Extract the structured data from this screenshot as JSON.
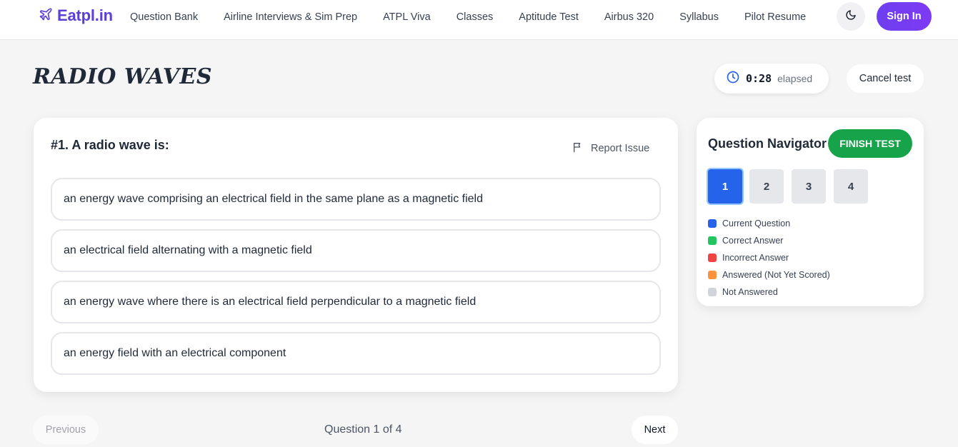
{
  "header": {
    "brand": "Eatpl.in",
    "nav_items": [
      "Question Bank",
      "Airline Interviews & Sim Prep",
      "ATPL Viva",
      "Classes",
      "Aptitude Test",
      "Airbus 320",
      "Syllabus",
      "Pilot Resume"
    ],
    "theme_icon": "moon-icon",
    "sign_in_label": "Sign In"
  },
  "page": {
    "title": "RADIO WAVES",
    "timer_value": "0:28",
    "timer_label": "elapsed",
    "cancel_label": "Cancel test"
  },
  "question": {
    "text": "#1. A radio wave is:",
    "report_label": "Report Issue",
    "options": [
      "an energy wave comprising an electrical field in the same plane as a magnetic field",
      "an electrical field alternating with a magnetic field",
      "an energy wave where there is an electrical field perpendicular to a magnetic field",
      "an energy field with an electrical component"
    ]
  },
  "navigator": {
    "title": "Question Navigator",
    "finish_label": "FINISH TEST",
    "questions": [
      "1",
      "2",
      "3",
      "4"
    ],
    "current": "1",
    "legend": [
      {
        "label": "Current Question",
        "color": "#2563eb"
      },
      {
        "label": "Correct Answer",
        "color": "#22c55e"
      },
      {
        "label": "Incorrect Answer",
        "color": "#ef4444"
      },
      {
        "label": "Answered (Not Yet Scored)",
        "color": "#fb923c"
      },
      {
        "label": "Not Answered",
        "color": "#d1d5db"
      }
    ]
  },
  "footer": {
    "previous_label": "Previous",
    "counter": "Question 1 of 4",
    "next_label": "Next"
  }
}
